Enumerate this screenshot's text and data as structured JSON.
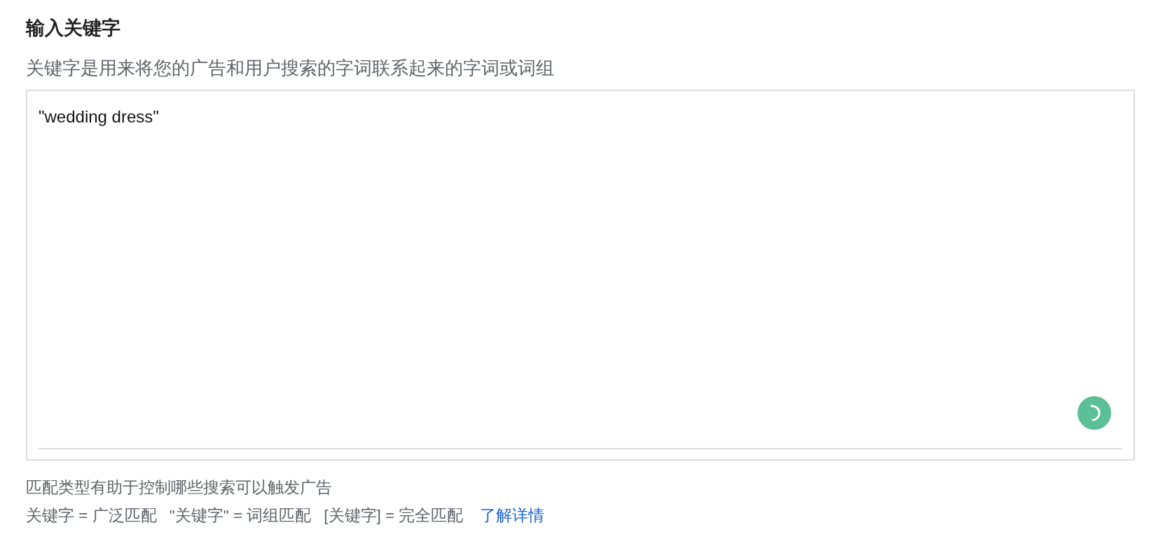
{
  "heading": "输入关键字",
  "description": "关键字是用来将您的广告和用户搜索的字词联系起来的字词或词组",
  "keyword_field": {
    "value": "\"wedding dress\""
  },
  "help_text": "匹配类型有助于控制哪些搜索可以触发广告",
  "match_types": [
    "关键字 = 广泛匹配",
    "\"关键字\" = 词组匹配",
    "[关键字] = 完全匹配"
  ],
  "learn_more_link": "了解详情"
}
